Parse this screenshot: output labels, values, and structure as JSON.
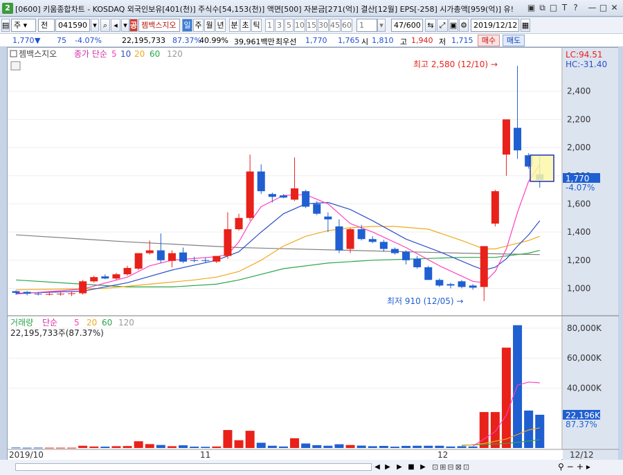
{
  "window": {
    "app_badge": "2",
    "title": "[0600] 키움종합차트 - KOSDAQ 외국인보유[401(천)] 주식수[54,153(천)] 액면[500] 자본금[271(억)] 결산[12월] EPS[-258] 시가총액[959(억)] 유!",
    "buttons": [
      "▣",
      "⧉",
      "□",
      "T",
      "?",
      "—",
      "□",
      "✕"
    ]
  },
  "toolbar": {
    "view_mode": "주",
    "market": "전",
    "code": "041590",
    "stock_name": "젬백스지오",
    "name_badge": "공",
    "periods": [
      "일",
      "주",
      "월",
      "년",
      "분",
      "초",
      "틱"
    ],
    "active_period": "일",
    "intervals": [
      "1",
      "3",
      "5",
      "10",
      "15",
      "30",
      "45",
      "60"
    ],
    "unit": "1",
    "count": "47",
    "count_total": "/600",
    "date": "2019/12/12"
  },
  "quote": {
    "price": "1,770",
    "arrow": "▼",
    "change": "75",
    "change_pct": "-4.07%",
    "volume": "22,195,733",
    "volume_ratio": "87.37%",
    "turnover": "40.99%",
    "amount": "39,961백만",
    "best_label": "최우선",
    "best_ask": "1,770",
    "best_bid": "1,765",
    "open_label": "시",
    "open": "1,810",
    "high_label": "고",
    "high": "1,940",
    "low_label": "저",
    "low": "1,715",
    "buy_button": "매수",
    "sell_button": "매도"
  },
  "price_panel": {
    "legend_name": "젬백스지오",
    "legend_ma": "종가 단순",
    "ma_periods": [
      "5",
      "10",
      "20",
      "60",
      "120"
    ],
    "lc": "LC:94.51",
    "hc": "HC:-31.40",
    "current_price": "1,770",
    "current_change": "-4.07%",
    "annotation_high": "최고 2,580 (12/10) →",
    "annotation_low": "최저 910 (12/05) →"
  },
  "volume_panel": {
    "legend_name": "거래량",
    "legend_ma": "단순",
    "ma_periods": [
      "5",
      "20",
      "60",
      "120"
    ],
    "summary": "22,195,733주(87.37%)",
    "current_volume": "22,196K",
    "current_pct": "87.37%"
  },
  "x_axis_labels": [
    "2019/10",
    "11",
    "12",
    "12/12"
  ],
  "colors": {
    "up": "#e8211a",
    "down": "#1f5fd1",
    "ma5": "#ff3fc0",
    "ma10": "#2e4fc8",
    "ma20": "#f0a81c",
    "ma60": "#2aa64a",
    "ma120": "#808080"
  },
  "chart_data": {
    "type": "candlestick",
    "price_axis": {
      "ticks": [
        1000,
        1200,
        1400,
        1600,
        1800,
        2000,
        2200,
        2400
      ],
      "range": [
        840,
        2620
      ]
    },
    "volume_axis": {
      "ticks": [
        "40,000K",
        "60,000K",
        "80,000K"
      ],
      "tick_values": [
        40000,
        60000,
        80000
      ],
      "range": [
        0,
        86000
      ]
    },
    "candles": [
      {
        "o": 980,
        "h": 985,
        "l": 955,
        "c": 968,
        "v": 300
      },
      {
        "o": 975,
        "h": 980,
        "l": 950,
        "c": 962,
        "v": 200
      },
      {
        "o": 962,
        "h": 972,
        "l": 950,
        "c": 958,
        "v": 250
      },
      {
        "o": 955,
        "h": 968,
        "l": 950,
        "c": 960,
        "v": 200
      },
      {
        "o": 958,
        "h": 970,
        "l": 948,
        "c": 962,
        "v": 200
      },
      {
        "o": 960,
        "h": 975,
        "l": 945,
        "c": 965,
        "v": 200
      },
      {
        "o": 965,
        "h": 1060,
        "l": 955,
        "c": 1050,
        "v": 1500
      },
      {
        "o": 1050,
        "h": 1090,
        "l": 1040,
        "c": 1080,
        "v": 1000
      },
      {
        "o": 1085,
        "h": 1100,
        "l": 1065,
        "c": 1070,
        "v": 900
      },
      {
        "o": 1070,
        "h": 1110,
        "l": 1060,
        "c": 1100,
        "v": 1200
      },
      {
        "o": 1100,
        "h": 1160,
        "l": 1090,
        "c": 1145,
        "v": 1300
      },
      {
        "o": 1140,
        "h": 1250,
        "l": 1130,
        "c": 1250,
        "v": 4500
      },
      {
        "o": 1250,
        "h": 1340,
        "l": 1240,
        "c": 1270,
        "v": 2600
      },
      {
        "o": 1270,
        "h": 1390,
        "l": 1180,
        "c": 1200,
        "v": 2000
      },
      {
        "o": 1195,
        "h": 1270,
        "l": 1150,
        "c": 1250,
        "v": 1200
      },
      {
        "o": 1255,
        "h": 1290,
        "l": 1180,
        "c": 1190,
        "v": 1800
      },
      {
        "o": 1200,
        "h": 1225,
        "l": 1185,
        "c": 1195,
        "v": 900
      },
      {
        "o": 1200,
        "h": 1220,
        "l": 1180,
        "c": 1195,
        "v": 800
      },
      {
        "o": 1190,
        "h": 1230,
        "l": 1180,
        "c": 1230,
        "v": 1000
      },
      {
        "o": 1230,
        "h": 1540,
        "l": 1210,
        "c": 1420,
        "v": 12000
      },
      {
        "o": 1420,
        "h": 1530,
        "l": 1410,
        "c": 1500,
        "v": 5200
      },
      {
        "o": 1500,
        "h": 1950,
        "l": 1480,
        "c": 1830,
        "v": 11500
      },
      {
        "o": 1830,
        "h": 1880,
        "l": 1670,
        "c": 1690,
        "v": 3500
      },
      {
        "o": 1670,
        "h": 1680,
        "l": 1610,
        "c": 1650,
        "v": 1500
      },
      {
        "o": 1660,
        "h": 1670,
        "l": 1640,
        "c": 1645,
        "v": 1000
      },
      {
        "o": 1630,
        "h": 1930,
        "l": 1620,
        "c": 1710,
        "v": 6500
      },
      {
        "o": 1690,
        "h": 1700,
        "l": 1570,
        "c": 1580,
        "v": 3000
      },
      {
        "o": 1600,
        "h": 1620,
        "l": 1520,
        "c": 1530,
        "v": 1900
      },
      {
        "o": 1510,
        "h": 1540,
        "l": 1400,
        "c": 1490,
        "v": 1500
      },
      {
        "o": 1440,
        "h": 1490,
        "l": 1250,
        "c": 1270,
        "v": 2500
      },
      {
        "o": 1280,
        "h": 1430,
        "l": 1250,
        "c": 1420,
        "v": 2000
      },
      {
        "o": 1420,
        "h": 1450,
        "l": 1340,
        "c": 1350,
        "v": 1600
      },
      {
        "o": 1350,
        "h": 1370,
        "l": 1320,
        "c": 1330,
        "v": 1200
      },
      {
        "o": 1330,
        "h": 1345,
        "l": 1260,
        "c": 1280,
        "v": 1400
      },
      {
        "o": 1280,
        "h": 1290,
        "l": 1240,
        "c": 1250,
        "v": 900
      },
      {
        "o": 1260,
        "h": 1270,
        "l": 1170,
        "c": 1200,
        "v": 1400
      },
      {
        "o": 1210,
        "h": 1230,
        "l": 1140,
        "c": 1150,
        "v": 1500
      },
      {
        "o": 1150,
        "h": 1160,
        "l": 1060,
        "c": 1060,
        "v": 1500
      },
      {
        "o": 1060,
        "h": 1070,
        "l": 1010,
        "c": 1020,
        "v": 1500
      },
      {
        "o": 1030,
        "h": 1040,
        "l": 1000,
        "c": 1020,
        "v": 1000
      },
      {
        "o": 1050,
        "h": 1060,
        "l": 1000,
        "c": 1010,
        "v": 1200
      },
      {
        "o": 1020,
        "h": 1030,
        "l": 990,
        "c": 1005,
        "v": 1000
      },
      {
        "o": 1010,
        "h": 1300,
        "l": 910,
        "c": 1300,
        "v": 24000
      },
      {
        "o": 1460,
        "h": 1700,
        "l": 1440,
        "c": 1690,
        "v": 24000
      },
      {
        "o": 1950,
        "h": 2200,
        "l": 1800,
        "c": 2200,
        "v": 67000
      },
      {
        "o": 2140,
        "h": 2580,
        "l": 1920,
        "c": 1980,
        "v": 82000
      },
      {
        "o": 1945,
        "h": 1960,
        "l": 1850,
        "c": 1865,
        "v": 25000
      },
      {
        "o": 1810,
        "h": 1940,
        "l": 1715,
        "c": 1770,
        "v": 22196
      }
    ],
    "ma_lines": {
      "ma5": [
        [
          0,
          960
        ],
        [
          6,
          995
        ],
        [
          10,
          1080
        ],
        [
          12,
          1160
        ],
        [
          14,
          1200
        ],
        [
          18,
          1225
        ],
        [
          19,
          1240
        ],
        [
          20,
          1330
        ],
        [
          21,
          1470
        ],
        [
          22,
          1580
        ],
        [
          24,
          1660
        ],
        [
          26,
          1665
        ],
        [
          28,
          1600
        ],
        [
          30,
          1460
        ],
        [
          32,
          1400
        ],
        [
          35,
          1290
        ],
        [
          38,
          1160
        ],
        [
          41,
          1050
        ],
        [
          42,
          1040
        ],
        [
          43,
          1120
        ],
        [
          44,
          1280
        ],
        [
          45,
          1540
        ],
        [
          46,
          1760
        ],
        [
          47,
          1880
        ]
      ],
      "ma10": [
        [
          0,
          965
        ],
        [
          6,
          980
        ],
        [
          10,
          1040
        ],
        [
          14,
          1130
        ],
        [
          18,
          1200
        ],
        [
          20,
          1260
        ],
        [
          22,
          1400
        ],
        [
          24,
          1530
        ],
        [
          26,
          1600
        ],
        [
          28,
          1610
        ],
        [
          30,
          1560
        ],
        [
          32,
          1480
        ],
        [
          35,
          1350
        ],
        [
          38,
          1260
        ],
        [
          41,
          1160
        ],
        [
          42,
          1130
        ],
        [
          43,
          1150
        ],
        [
          44,
          1210
        ],
        [
          45,
          1300
        ],
        [
          46,
          1380
        ],
        [
          47,
          1480
        ]
      ],
      "ma20": [
        [
          0,
          990
        ],
        [
          8,
          1000
        ],
        [
          12,
          1030
        ],
        [
          16,
          1060
        ],
        [
          18,
          1080
        ],
        [
          20,
          1120
        ],
        [
          22,
          1200
        ],
        [
          24,
          1300
        ],
        [
          26,
          1370
        ],
        [
          28,
          1410
        ],
        [
          30,
          1430
        ],
        [
          32,
          1440
        ],
        [
          34,
          1440
        ],
        [
          37,
          1420
        ],
        [
          40,
          1340
        ],
        [
          42,
          1280
        ],
        [
          43,
          1280
        ],
        [
          44,
          1300
        ],
        [
          46,
          1340
        ],
        [
          47,
          1370
        ]
      ],
      "ma60": [
        [
          0,
          1060
        ],
        [
          6,
          1030
        ],
        [
          10,
          1010
        ],
        [
          14,
          1010
        ],
        [
          18,
          1030
        ],
        [
          20,
          1060
        ],
        [
          24,
          1140
        ],
        [
          28,
          1180
        ],
        [
          32,
          1200
        ],
        [
          36,
          1210
        ],
        [
          40,
          1220
        ],
        [
          43,
          1220
        ],
        [
          46,
          1250
        ],
        [
          47,
          1270
        ]
      ],
      "ma120": [
        [
          0,
          1380
        ],
        [
          10,
          1330
        ],
        [
          20,
          1290
        ],
        [
          30,
          1270
        ],
        [
          40,
          1250
        ],
        [
          47,
          1240
        ]
      ],
      "vol_ma5": [
        [
          41,
          1200
        ],
        [
          42,
          6000
        ],
        [
          43,
          11000
        ],
        [
          44,
          22000
        ],
        [
          45,
          42000
        ],
        [
          46,
          44000
        ],
        [
          47,
          43500
        ]
      ],
      "vol_ma20": [
        [
          40,
          1500
        ],
        [
          42,
          3000
        ],
        [
          44,
          6000
        ],
        [
          45,
          9000
        ],
        [
          46,
          12000
        ],
        [
          47,
          13500
        ]
      ],
      "vol_ma60": [
        [
          40,
          1800
        ],
        [
          44,
          3000
        ],
        [
          47,
          5500
        ]
      ]
    }
  }
}
